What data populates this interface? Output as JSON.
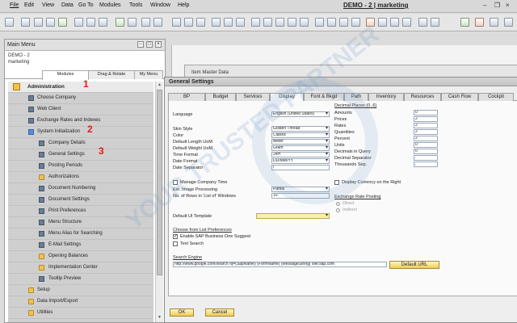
{
  "menubar": {
    "items": [
      "File",
      "Edit",
      "View",
      "Data",
      "Go To",
      "Modules",
      "Tools",
      "Window",
      "Help"
    ],
    "app_title": "DEMO - 2 | marketing"
  },
  "main_menu": {
    "title": "Main Menu",
    "company": "DEMO - 2",
    "user": "marketing",
    "tabs": [
      "Modules",
      "Drag & Relate",
      "My Menu"
    ],
    "items": [
      {
        "label": "Administration",
        "type": "header"
      },
      {
        "label": "Choose Company",
        "type": "doc"
      },
      {
        "label": "Web Client",
        "type": "doc"
      },
      {
        "label": "Exchange Rates and Indexes",
        "type": "doc"
      },
      {
        "label": "System Initialization",
        "type": "openfolder"
      },
      {
        "label": "Company Details",
        "type": "doc"
      },
      {
        "label": "General Settings",
        "type": "doc"
      },
      {
        "label": "Posting Periods",
        "type": "doc"
      },
      {
        "label": "Authorizations",
        "type": "folder"
      },
      {
        "label": "Document Numbering",
        "type": "doc"
      },
      {
        "label": "Document Settings",
        "type": "doc"
      },
      {
        "label": "Print Preferences",
        "type": "doc"
      },
      {
        "label": "Menu Structure",
        "type": "doc"
      },
      {
        "label": "Menu Alias for Searching",
        "type": "doc"
      },
      {
        "label": "E-Mail Settings",
        "type": "doc"
      },
      {
        "label": "Opening Balances",
        "type": "folder"
      },
      {
        "label": "Implementation Center",
        "type": "folder"
      },
      {
        "label": "Tooltip Preview",
        "type": "doc"
      },
      {
        "label": "Setup",
        "type": "folder"
      },
      {
        "label": "Data Import/Export",
        "type": "folder"
      },
      {
        "label": "Utilities",
        "type": "folder"
      }
    ],
    "annotations": [
      "1",
      "2",
      "3"
    ]
  },
  "item_master": {
    "title": "Item Master Data"
  },
  "general_settings": {
    "title": "General Settings",
    "tabs": [
      "BP",
      "Budget",
      "Services",
      "Display",
      "Font & Bkgd",
      "Path",
      "Inventory",
      "Resources",
      "Cash Flow",
      "Cockpit"
    ],
    "left_fields": [
      {
        "label": "Language",
        "value": "English (United States)"
      },
      {
        "label": "Skin Style",
        "value": "Golden Thread"
      },
      {
        "label": "Color",
        "value": "Classic"
      },
      {
        "label": "Default Length UoM",
        "value": "Meter"
      },
      {
        "label": "Default Weight UoM",
        "value": "Gram"
      },
      {
        "label": "Time Format",
        "value": "24H"
      },
      {
        "label": "Date Format",
        "value": "DD/MM/YY"
      },
      {
        "label": "Date Separator",
        "value": "/"
      }
    ],
    "manage_company_time": "Manage Company Time",
    "ext_image_label": "Ext. Image Processing",
    "ext_image_value": "Partial",
    "rows_label": "No. of Rows in 'List of' Windows",
    "rows_value": "10",
    "default_ui_template": "Default UI Template",
    "cfl_title": "Choose from List Preferences",
    "enable_suggest": "Enable SAP Business One Suggest",
    "text_search": "Text Search",
    "search_engine_title": "Search Engine",
    "search_engine_value": "http://www.google.com/search?q={SapName} {FormName} {MessageString} site:sap.com",
    "default_url": "Default URL",
    "decimal_title": "Decimal Places (0..6)",
    "decimals": [
      {
        "label": "Amounts",
        "value": "0"
      },
      {
        "label": "Prices",
        "value": "2"
      },
      {
        "label": "Rates",
        "value": "2"
      },
      {
        "label": "Quantities",
        "value": "2"
      },
      {
        "label": "Percent",
        "value": "2"
      },
      {
        "label": "Units",
        "value": "0"
      },
      {
        "label": "Decimals in Query",
        "value": "0"
      },
      {
        "label": "Decimal Separator",
        "value": "."
      },
      {
        "label": "Thousands Sep.",
        "value": ","
      }
    ],
    "display_currency_right": "Display Currency on the Right",
    "exchange_title": "Exchange Rate Posting",
    "direct": "Direct",
    "indirect": "Indirect",
    "ok": "OK",
    "cancel": "Cancel"
  },
  "watermark": {
    "text1": "YOUR TRUSTED PARTNER"
  }
}
